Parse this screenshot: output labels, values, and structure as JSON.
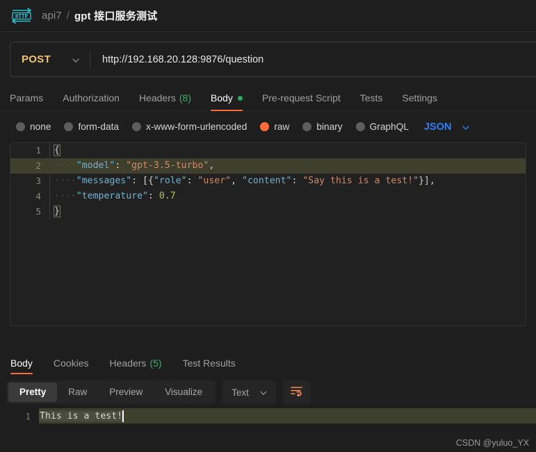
{
  "header": {
    "icon": "http-protocol-icon",
    "workspace": "api7",
    "separator": "/",
    "title": "gpt 接口服务测试"
  },
  "url_bar": {
    "method": "POST",
    "method_caret": "chevron-down-icon",
    "url": "http://192.168.20.128:9876/question"
  },
  "request_tabs": [
    {
      "label": "Params",
      "count": "",
      "active": false,
      "dot": false
    },
    {
      "label": "Authorization",
      "count": "",
      "active": false,
      "dot": false
    },
    {
      "label": "Headers",
      "count": "(8)",
      "active": false,
      "dot": false
    },
    {
      "label": "Body",
      "count": "",
      "active": true,
      "dot": true
    },
    {
      "label": "Pre-request Script",
      "count": "",
      "active": false,
      "dot": false
    },
    {
      "label": "Tests",
      "count": "",
      "active": false,
      "dot": false
    },
    {
      "label": "Settings",
      "count": "",
      "active": false,
      "dot": false
    }
  ],
  "body_types": [
    {
      "label": "none",
      "selected": false
    },
    {
      "label": "form-data",
      "selected": false
    },
    {
      "label": "x-www-form-urlencoded",
      "selected": false
    },
    {
      "label": "raw",
      "selected": true
    },
    {
      "label": "binary",
      "selected": false
    },
    {
      "label": "GraphQL",
      "selected": false
    }
  ],
  "format_select": {
    "value": "JSON",
    "caret": "chevron-down-icon"
  },
  "request_body": {
    "lines": [
      {
        "num": "1",
        "highlighted": false
      },
      {
        "num": "2",
        "highlighted": true
      },
      {
        "num": "3",
        "highlighted": false
      },
      {
        "num": "4",
        "highlighted": false
      },
      {
        "num": "5",
        "highlighted": false
      }
    ],
    "raw_text": "{\n    \"model\": \"gpt-3.5-turbo\",\n    \"messages\": [{\"role\": \"user\", \"content\": \"Say this is a test!\"}],\n    \"temperature\": 0.7\n}",
    "tokens": {
      "line1": "{",
      "line2_key": "\"model\"",
      "line2_val": "\"gpt-3.5-turbo\"",
      "line3_key": "\"messages\"",
      "line3_role_key": "\"role\"",
      "line3_role_val": "\"user\"",
      "line3_content_key": "\"content\"",
      "line3_content_val": "\"Say this is a test!\"",
      "line4_key": "\"temperature\"",
      "line4_val": "0.7",
      "line5": "}"
    }
  },
  "response_tabs": [
    {
      "label": "Body",
      "count": "",
      "active": true
    },
    {
      "label": "Cookies",
      "count": "",
      "active": false
    },
    {
      "label": "Headers",
      "count": "(5)",
      "active": false
    },
    {
      "label": "Test Results",
      "count": "",
      "active": false
    }
  ],
  "view_modes": [
    {
      "label": "Pretty",
      "active": true
    },
    {
      "label": "Raw",
      "active": false
    },
    {
      "label": "Preview",
      "active": false
    },
    {
      "label": "Visualize",
      "active": false
    }
  ],
  "content_type": {
    "value": "Text",
    "caret": "chevron-down-icon"
  },
  "wrap_button": {
    "icon": "wrap-text-icon"
  },
  "response_body": {
    "line_number": "1",
    "text": "This is a test!"
  },
  "watermark": "CSDN @yuluo_YX",
  "colors": {
    "accent": "#ff6c37",
    "method": "#f0c674",
    "green": "#27ad62",
    "blue": "#2d7ff9",
    "bg": "#1e1e1e",
    "editor_bg": "#212121",
    "line_highlight": "#3f3f2e"
  }
}
